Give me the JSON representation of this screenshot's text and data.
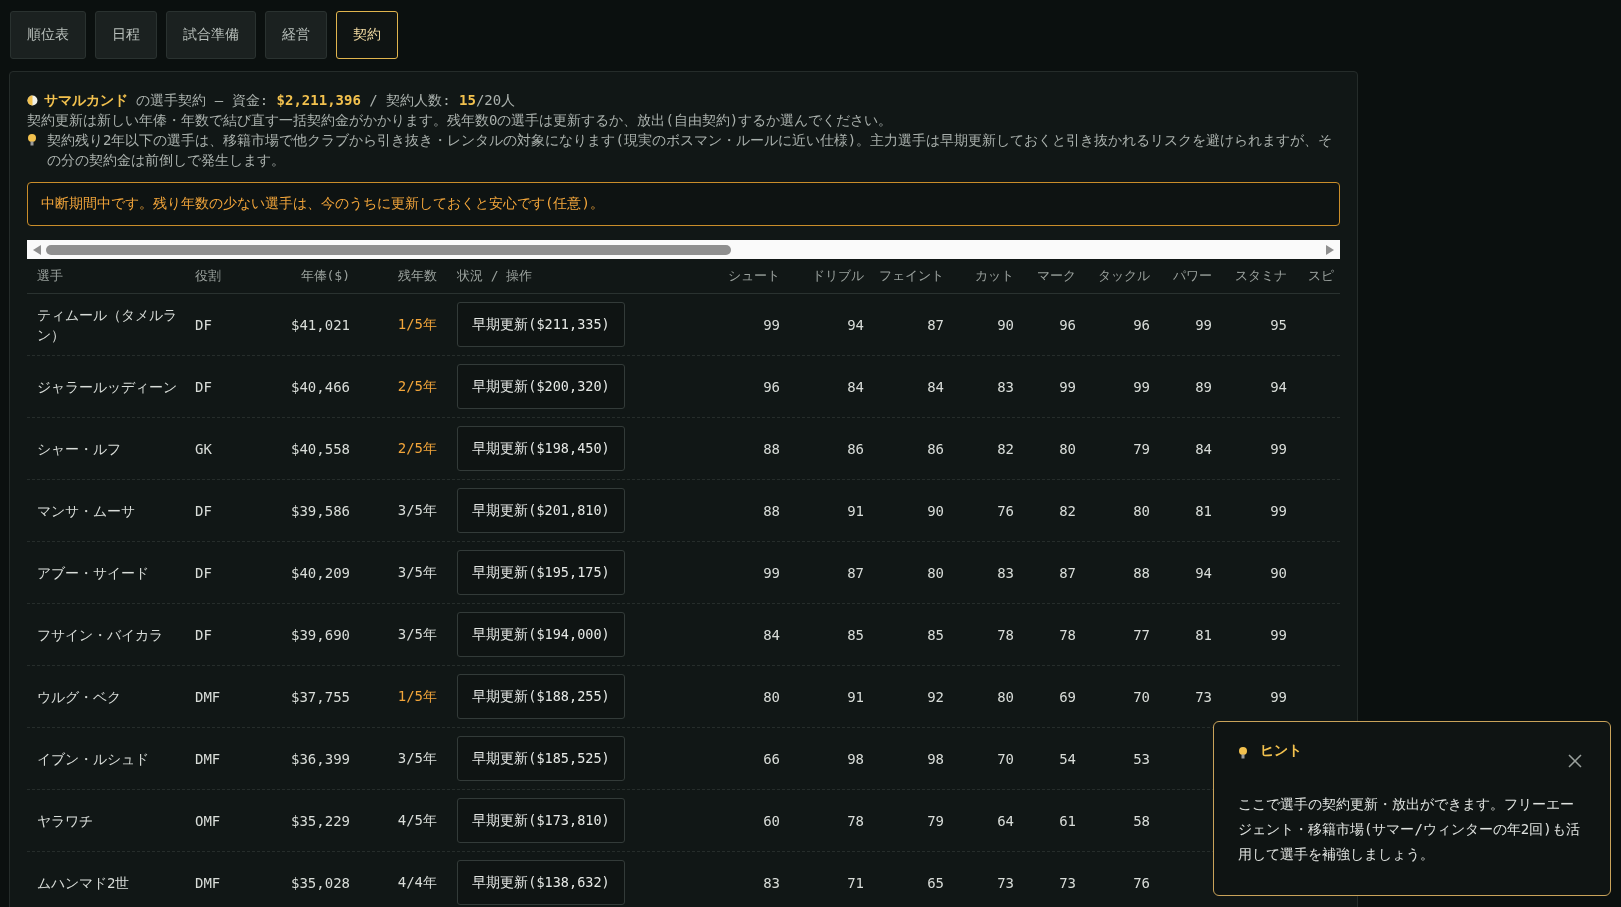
{
  "tabs": [
    {
      "label": "順位表",
      "selected": false
    },
    {
      "label": "日程",
      "selected": false
    },
    {
      "label": "試合準備",
      "selected": false
    },
    {
      "label": "経営",
      "selected": false
    },
    {
      "label": "契約",
      "selected": true
    }
  ],
  "summary": {
    "headline": "**サマルカンド** の選手契約 — 資金: **$2,211,396** / 契約人数: **15**/20人",
    "note": "契約更新は新しい年俸・年数で結び直す一括契約金がかかります。残年数0の選手は更新するか、放出(自由契約)するか選んでください。",
    "tip": "契約残り2年以下の選手は、移籍市場で他クラブから引き抜き・レンタルの対象になります(現実のボスマン・ルールに近い仕様)。主力選手は早期更新しておくと引き抜かれるリスクを避けられますが、その分の契約金は前倒しで発生します。"
  },
  "alert": "中断期間中です。残り年数の少ない選手は、今のうちに更新しておくと安心です(任意)。",
  "table": {
    "columns": [
      "選手",
      "役割",
      "年俸($)",
      "残年数",
      "状況 / 操作",
      "シュート",
      "ドリブル",
      "フェイント",
      "カット",
      "マーク",
      "タックル",
      "パワー",
      "スタミナ",
      "スピ"
    ],
    "rows": [
      {
        "player": "ティムール（タメルラン）",
        "role": "DF",
        "salary": "$41,021",
        "years": "1/5年",
        "expiring": true,
        "action": "早期更新($211,335)",
        "stats": [
          "99",
          "94",
          "87",
          "90",
          "96",
          "96",
          "99",
          "95"
        ]
      },
      {
        "player": "ジャラールッディーン",
        "role": "DF",
        "salary": "$40,466",
        "years": "2/5年",
        "expiring": true,
        "action": "早期更新($200,320)",
        "stats": [
          "96",
          "84",
          "84",
          "83",
          "99",
          "99",
          "89",
          "94"
        ]
      },
      {
        "player": "シャー・ルフ",
        "role": "GK",
        "salary": "$40,558",
        "years": "2/5年",
        "expiring": true,
        "action": "早期更新($198,450)",
        "stats": [
          "88",
          "86",
          "86",
          "82",
          "80",
          "79",
          "84",
          "99"
        ]
      },
      {
        "player": "マンサ・ムーサ",
        "role": "DF",
        "salary": "$39,586",
        "years": "3/5年",
        "expiring": false,
        "action": "早期更新($201,810)",
        "stats": [
          "88",
          "91",
          "90",
          "76",
          "82",
          "80",
          "81",
          "99"
        ]
      },
      {
        "player": "アブー・サイード",
        "role": "DF",
        "salary": "$40,209",
        "years": "3/5年",
        "expiring": false,
        "action": "早期更新($195,175)",
        "stats": [
          "99",
          "87",
          "80",
          "83",
          "87",
          "88",
          "94",
          "90"
        ]
      },
      {
        "player": "フサイン・バイカラ",
        "role": "DF",
        "salary": "$39,690",
        "years": "3/5年",
        "expiring": false,
        "action": "早期更新($194,000)",
        "stats": [
          "84",
          "85",
          "85",
          "78",
          "78",
          "77",
          "81",
          "99"
        ]
      },
      {
        "player": "ウルグ・ベク",
        "role": "DMF",
        "salary": "$37,755",
        "years": "1/5年",
        "expiring": true,
        "action": "早期更新($188,255)",
        "stats": [
          "80",
          "91",
          "92",
          "80",
          "69",
          "70",
          "73",
          "99"
        ]
      },
      {
        "player": "イブン・ルシュド",
        "role": "DMF",
        "salary": "$36,399",
        "years": "3/5年",
        "expiring": false,
        "action": "早期更新($185,525)",
        "stats": [
          "66",
          "98",
          "98",
          "70",
          "54",
          "53"
        ]
      },
      {
        "player": "ヤラワチ",
        "role": "OMF",
        "salary": "$35,229",
        "years": "4/5年",
        "expiring": false,
        "action": "早期更新($173,810)",
        "stats": [
          "60",
          "78",
          "79",
          "64",
          "61",
          "58"
        ]
      },
      {
        "player": "ムハンマド2世",
        "role": "DMF",
        "salary": "$35,028",
        "years": "4/4年",
        "expiring": false,
        "action": "早期更新($138,632)",
        "stats": [
          "83",
          "71",
          "65",
          "73",
          "73",
          "76"
        ]
      }
    ]
  },
  "hint": {
    "title": "ヒント",
    "text": "ここで選手の契約更新・放出ができます。フリーエージェント・移籍市場(サマー/ウィンターの年2回)も活用して選手を補強しましょう。"
  }
}
